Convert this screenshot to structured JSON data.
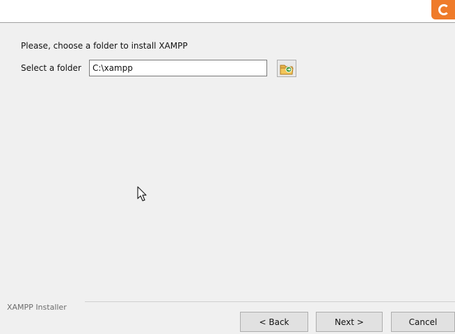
{
  "header": {
    "logo_icon": "xampp-logo-icon",
    "accent_color": "#ef7b2a"
  },
  "main": {
    "prompt": "Please, choose a folder to install XAMPP",
    "folder_label": "Select a folder",
    "folder_value": "C:\\xampp",
    "browse_icon": "folder-browse-icon"
  },
  "footer": {
    "group_label": "XAMPP Installer",
    "back_label": "< Back",
    "next_label": "Next >",
    "cancel_label": "Cancel"
  }
}
